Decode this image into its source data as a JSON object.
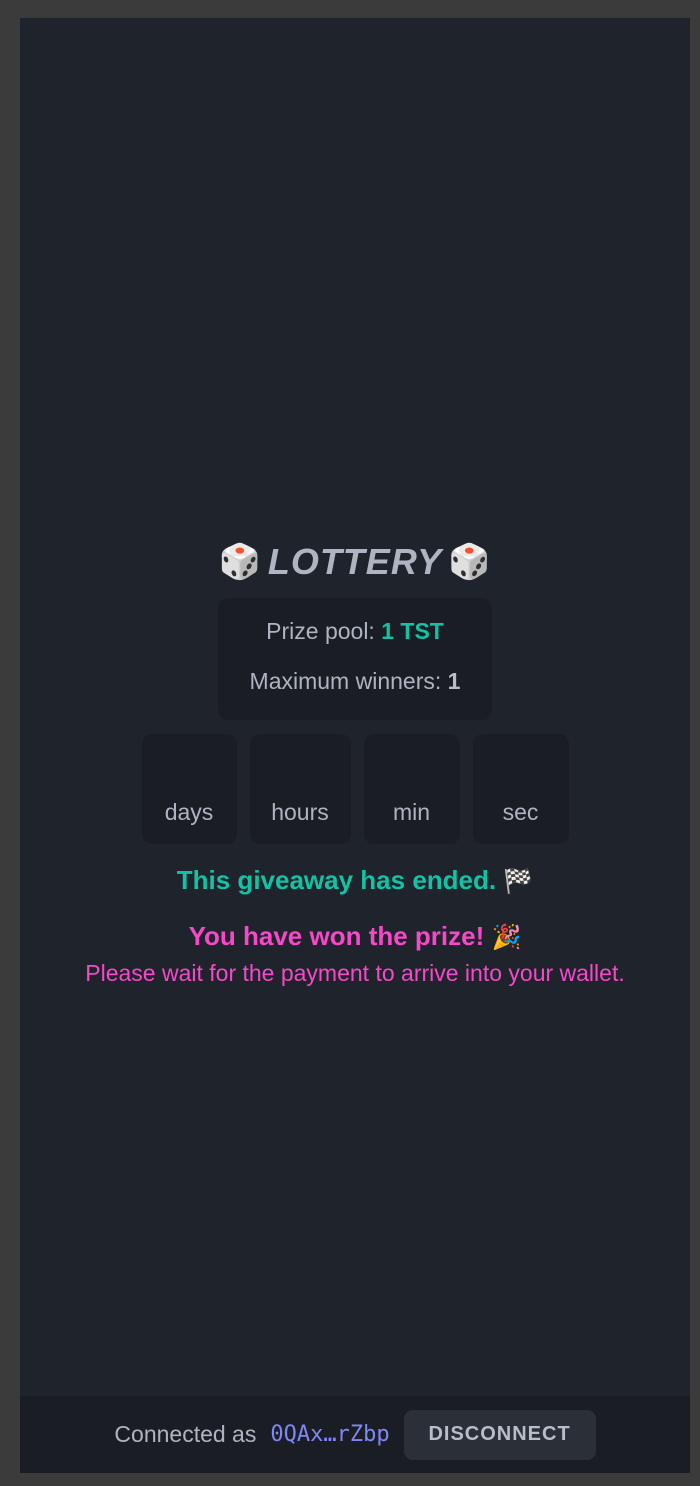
{
  "lottery": {
    "title": "LOTTERY",
    "dice_icon": "🎲",
    "prize_pool_label": "Prize pool:",
    "prize_pool_value": "1 TST",
    "max_winners_label": "Maximum winners:",
    "max_winners_value": "1"
  },
  "countdown": {
    "days_label": "days",
    "hours_label": "hours",
    "min_label": "min",
    "sec_label": "sec"
  },
  "status": {
    "ended_text": "This giveaway has ended.",
    "ended_icon": "🏁",
    "won_text": "You have won the prize!",
    "won_icon": "🎉",
    "wait_text": "Please wait for the payment to arrive into your wallet."
  },
  "footer": {
    "connected_label": "Connected as",
    "address": "0QAx…rZbp",
    "disconnect_label": "DISCONNECT"
  },
  "colors": {
    "background": "#1f242c",
    "card": "#1a1e24",
    "text": "#aeb4c1",
    "accent_green": "#13c2a4",
    "accent_pink": "#f748c9",
    "address": "#7f86f6"
  }
}
